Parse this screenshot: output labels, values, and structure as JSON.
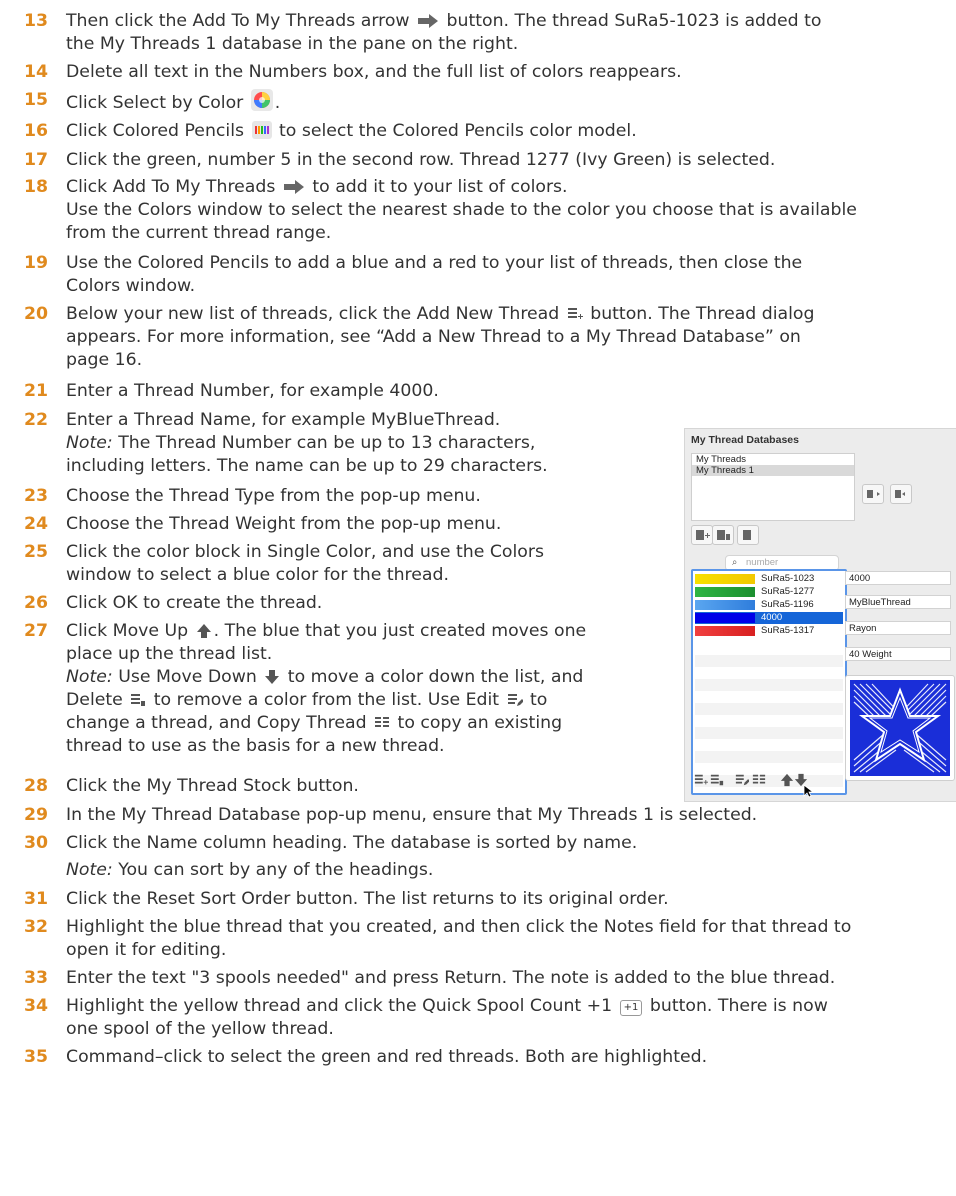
{
  "steps": [
    {
      "num": "13",
      "line1a": "Then click the Add To My Threads arrow ",
      "line1b": " button. The thread SuRa5-1023 is added to",
      "line2": "the My Threads 1 database in the pane on the right."
    },
    {
      "num": "14",
      "text": "Delete all text in the Numbers box, and the full list of colors reappears."
    },
    {
      "num": "15",
      "a": "Click Select by Color ",
      "b": "."
    },
    {
      "num": "16",
      "a": "Click Colored Pencils ",
      "b": " to select the Colored Pencils color model."
    },
    {
      "num": "17",
      "text": "Click the green, number 5 in the second row. Thread 1277 (Ivy Green) is selected."
    },
    {
      "num": "18",
      "a": "Click Add To My Threads ",
      "b": " to add it to your list of colors.",
      "line2": "Use the Colors window to select the nearest shade to the color you choose that is available",
      "line3": "from the current thread range."
    },
    {
      "num": "19",
      "line1": "Use the Colored Pencils to add a blue and a red to your list of threads, then close the",
      "line2": "Colors window."
    },
    {
      "num": "20",
      "a": "Below your new list of threads, click the Add New Thread ",
      "b": " button. The Thread dialog",
      "line2": "appears. For more information, see “Add a New Thread to a My Thread Database” on",
      "line3": "page 16."
    },
    {
      "num": "21",
      "text": "Enter a Thread Number, for example 4000."
    },
    {
      "num": "22",
      "line1": "Enter a Thread Name, for example MyBlueThread.",
      "note": "Note:",
      "line2": " The Thread Number can be up to 13 characters,",
      "line3": "including letters. The name can be up to 29 characters."
    },
    {
      "num": "23",
      "text": "Choose the Thread Type from the pop-up menu."
    },
    {
      "num": "24",
      "text": "Choose the Thread Weight from the pop-up menu."
    },
    {
      "num": "25",
      "line1": "Click the color block in Single Color, and use the Colors",
      "line2": "window to select a blue color for the thread."
    },
    {
      "num": "26",
      "text": "Click OK to create the thread."
    },
    {
      "num": "27",
      "a": "Click Move Up ",
      "b": ". The blue that you just created moves one",
      "line2": "place up the thread list.",
      "note": "Note:",
      "l3a": " Use Move Down ",
      "l3b": " to move a color down the list, and",
      "l4a": "Delete ",
      "l4b": " to remove a color from the list. Use Edit ",
      "l4c": " to",
      "l5a": "change a thread, and Copy Thread ",
      "l5b": " to copy an existing",
      "line6": "thread to use as the basis for a new thread."
    },
    {
      "num": "28",
      "text": "Click the My Thread Stock button."
    },
    {
      "num": "29",
      "text": "In the My Thread Database pop-up menu, ensure that My Threads 1 is selected."
    },
    {
      "num": "30",
      "text": "Click the Name column heading. The database is sorted by name.",
      "note": "Note:",
      "line2": " You can sort by any of the headings."
    },
    {
      "num": "31",
      "text": "Click the Reset Sort Order button. The list returns to its original order."
    },
    {
      "num": "32",
      "line1": "Highlight the blue thread that you created, and then click the Notes field for that thread to",
      "line2": "open it for editing."
    },
    {
      "num": "33",
      "text": "Enter the text \"3 spools needed\" and press Return. The note is added to the blue thread."
    },
    {
      "num": "34",
      "a": "Highlight the yellow thread and click the Quick Spool Count +1 ",
      "icon": "+1",
      "b": " button. There is now",
      "line2": "one spool of the yellow thread."
    },
    {
      "num": "35",
      "text": "Command–click to select the green and red threads. Both are highlighted."
    }
  ],
  "panel": {
    "title": "My Thread Databases",
    "databases": [
      "My Threads",
      "My Threads 1"
    ],
    "search_placeholder": "number",
    "threads": [
      {
        "label": "SuRa5-1023",
        "color": "#f2d000"
      },
      {
        "label": "SuRa5-1277",
        "color": "#22a33a"
      },
      {
        "label": "SuRa5-1196",
        "color": "#3a8ee6"
      },
      {
        "label": "4000",
        "color": "#0000e0"
      },
      {
        "label": "SuRa5-1317",
        "color": "#e82a2a"
      }
    ],
    "fields": [
      "4000",
      "MyBlueThread",
      "Rayon",
      "40 Weight"
    ],
    "accent": "#1565d8",
    "star_color": "#1a2ed8"
  }
}
